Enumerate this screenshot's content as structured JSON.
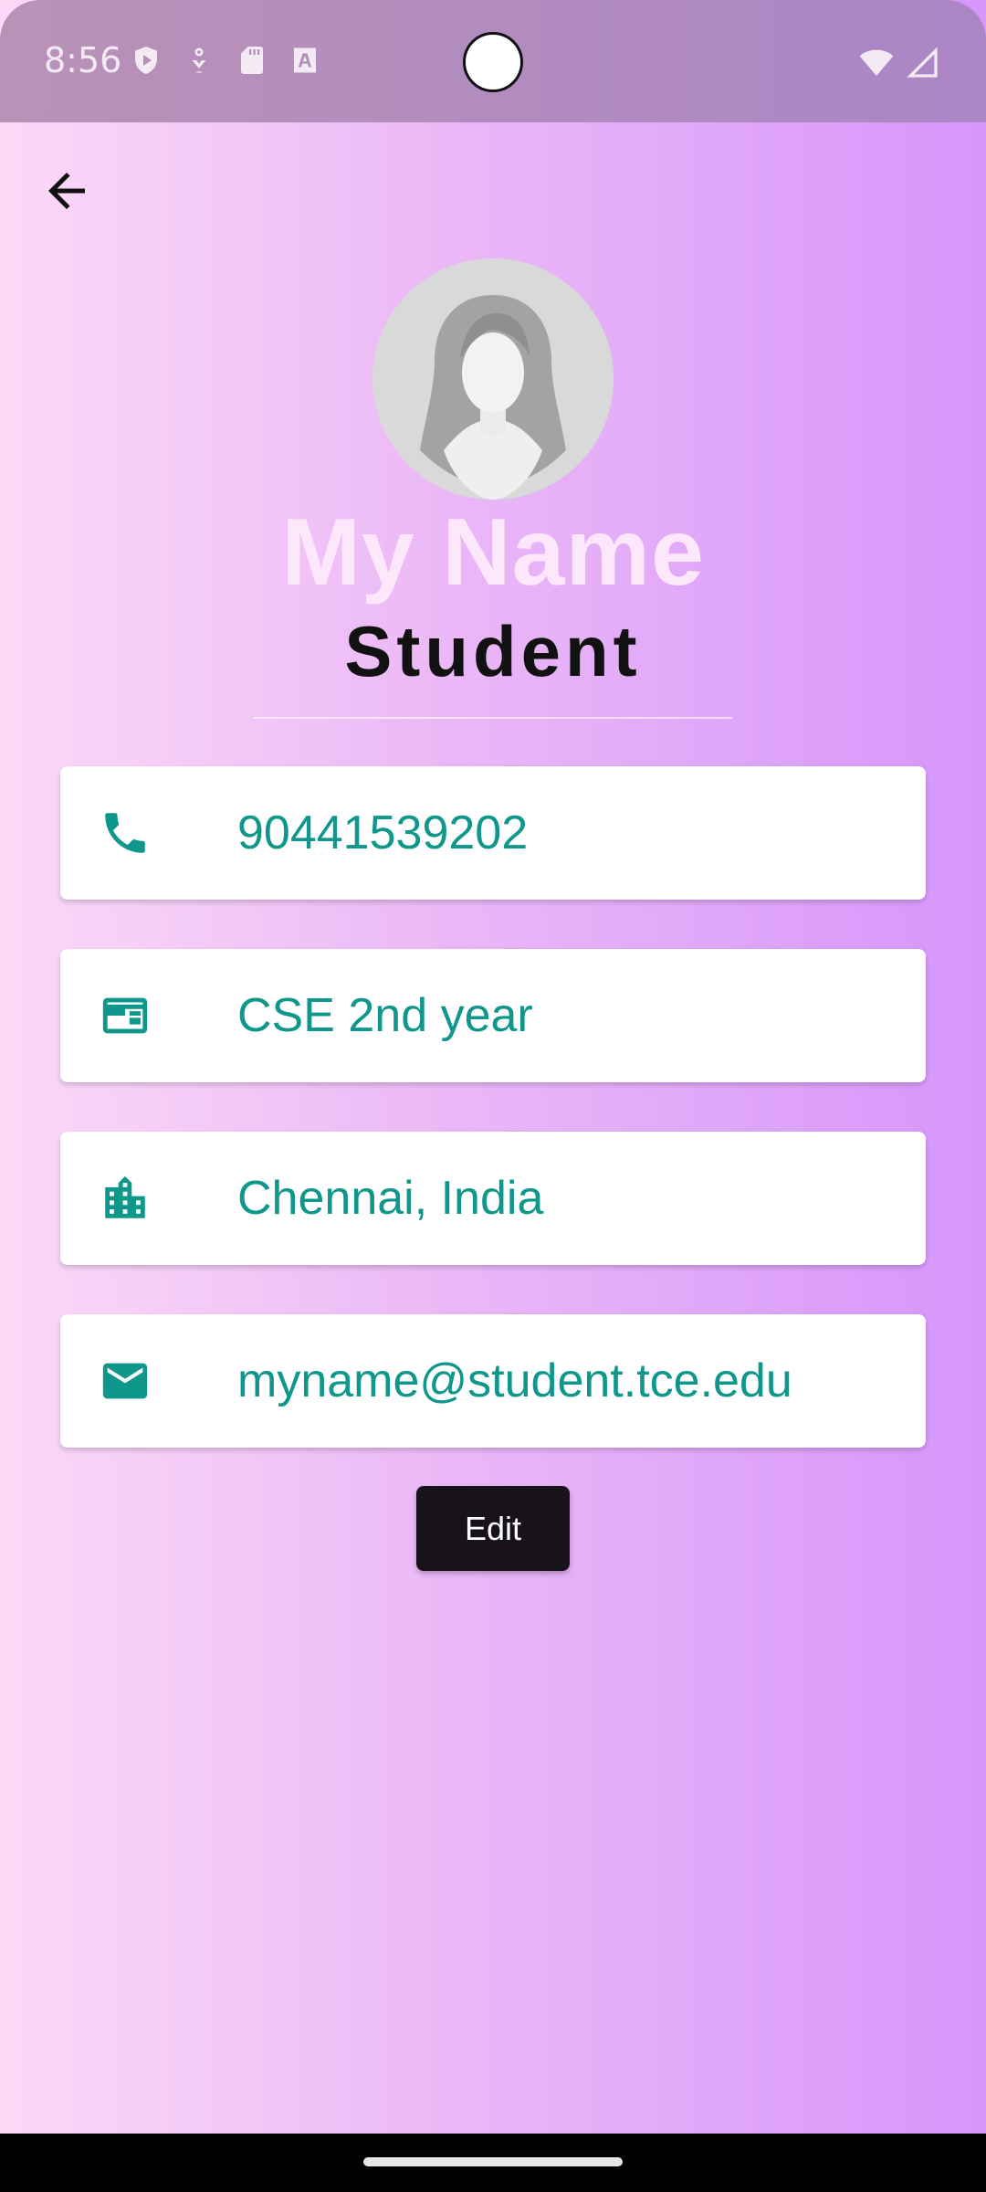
{
  "status_bar": {
    "time": "8:56",
    "icons": [
      "shield-play-icon",
      "download-icon",
      "sd-card-icon",
      "text-a-icon"
    ],
    "right_icons": [
      "wifi-icon",
      "signal-icon"
    ]
  },
  "profile": {
    "name": "My Name",
    "role": "Student"
  },
  "info_cards": [
    {
      "icon": "phone-icon",
      "value": "90441539202"
    },
    {
      "icon": "card-icon",
      "value": "CSE 2nd year"
    },
    {
      "icon": "building-icon",
      "value": "Chennai, India"
    },
    {
      "icon": "mail-icon",
      "value": "myname@student.tce.edu"
    }
  ],
  "actions": {
    "edit_label": "Edit"
  },
  "colors": {
    "accent": "#0e978a",
    "name_text": "#fde8fb",
    "button_bg": "#18131a",
    "gradient_start": "#fcd9f7",
    "gradient_end": "#d696fb"
  }
}
